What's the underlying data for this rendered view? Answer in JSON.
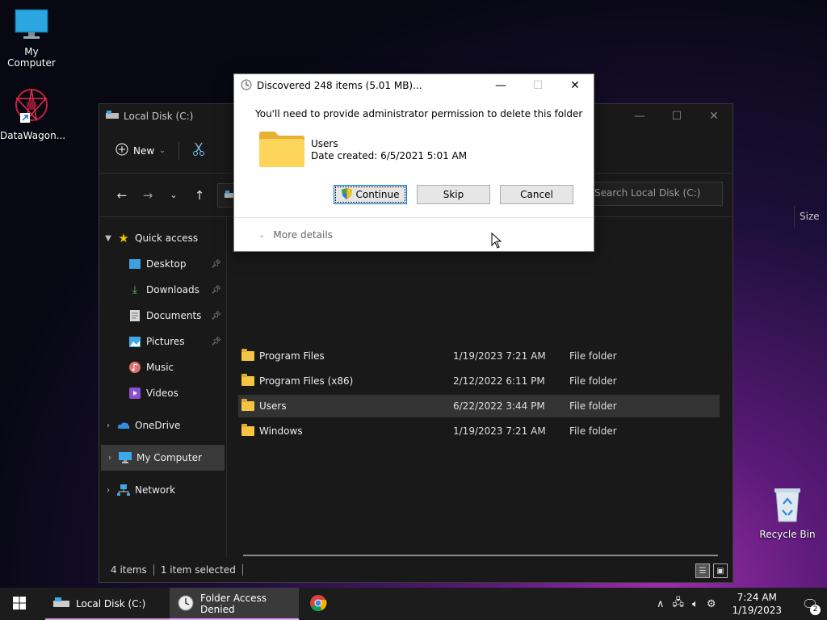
{
  "desktop": {
    "icons": [
      {
        "label": "My Computer",
        "icon": "monitor-icon"
      },
      {
        "label": "DataWagon...",
        "icon": "app-shortcut-icon"
      },
      {
        "label": "Recycle Bin",
        "icon": "recycle-bin-icon"
      }
    ]
  },
  "explorer": {
    "title": "Local Disk (C:)",
    "toolbar": {
      "new_label": "New"
    },
    "search_placeholder": "Search Local Disk (C:)",
    "column_size": "Size",
    "nav": {
      "quick_access": "Quick access",
      "items": [
        {
          "label": "Desktop",
          "icon": "desktop-icon"
        },
        {
          "label": "Downloads",
          "icon": "download-icon"
        },
        {
          "label": "Documents",
          "icon": "documents-icon"
        },
        {
          "label": "Pictures",
          "icon": "pictures-icon"
        },
        {
          "label": "Music",
          "icon": "music-icon"
        },
        {
          "label": "Videos",
          "icon": "videos-icon"
        }
      ],
      "onedrive": "OneDrive",
      "my_computer": "My Computer",
      "network": "Network"
    },
    "files": [
      {
        "name": "Program Files",
        "date": "1/19/2023 7:21 AM",
        "type": "File folder"
      },
      {
        "name": "Program Files (x86)",
        "date": "2/12/2022 6:11 PM",
        "type": "File folder"
      },
      {
        "name": "Users",
        "date": "6/22/2022 3:44 PM",
        "type": "File folder"
      },
      {
        "name": "Windows",
        "date": "1/19/2023 7:21 AM",
        "type": "File folder"
      }
    ],
    "status": {
      "count": "4 items",
      "selected": "1 item selected"
    }
  },
  "dialog": {
    "title": "Discovered 248 items (5.01 MB)...",
    "message": "You'll need to provide administrator permission to delete this folder",
    "folder_name": "Users",
    "date_created": "Date created: 6/5/2021 5:01 AM",
    "continue_label": "Continue",
    "skip_label": "Skip",
    "cancel_label": "Cancel",
    "more_details": "More details"
  },
  "taskbar": {
    "tasks": [
      {
        "label": "Local Disk (C:)"
      },
      {
        "label": "Folder Access Denied"
      }
    ],
    "time": "7:24 AM",
    "date": "1/19/2023",
    "notification_count": "2"
  },
  "colors": {
    "accent": "#0078d7",
    "folder": "#f4c542",
    "taskbar": "#1c1c1c"
  }
}
